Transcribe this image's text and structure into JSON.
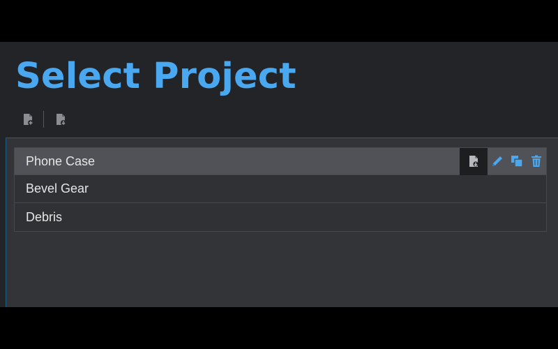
{
  "header": {
    "title": "Select Project"
  },
  "toolbar": {
    "buttons": [
      {
        "icon": "new-project-icon"
      },
      {
        "icon": "import-project-icon"
      }
    ]
  },
  "projects": [
    {
      "name": "Phone Case",
      "selected": true
    },
    {
      "name": "Bevel Gear",
      "selected": false
    },
    {
      "name": "Debris",
      "selected": false
    }
  ],
  "row_actions": [
    "open-icon",
    "edit-icon",
    "duplicate-icon",
    "delete-icon"
  ],
  "colors": {
    "accent": "#4aa8f0",
    "background": "#232427",
    "panel": "#323438",
    "selected_row": "#505257",
    "icon_gray": "#8a8d92"
  }
}
